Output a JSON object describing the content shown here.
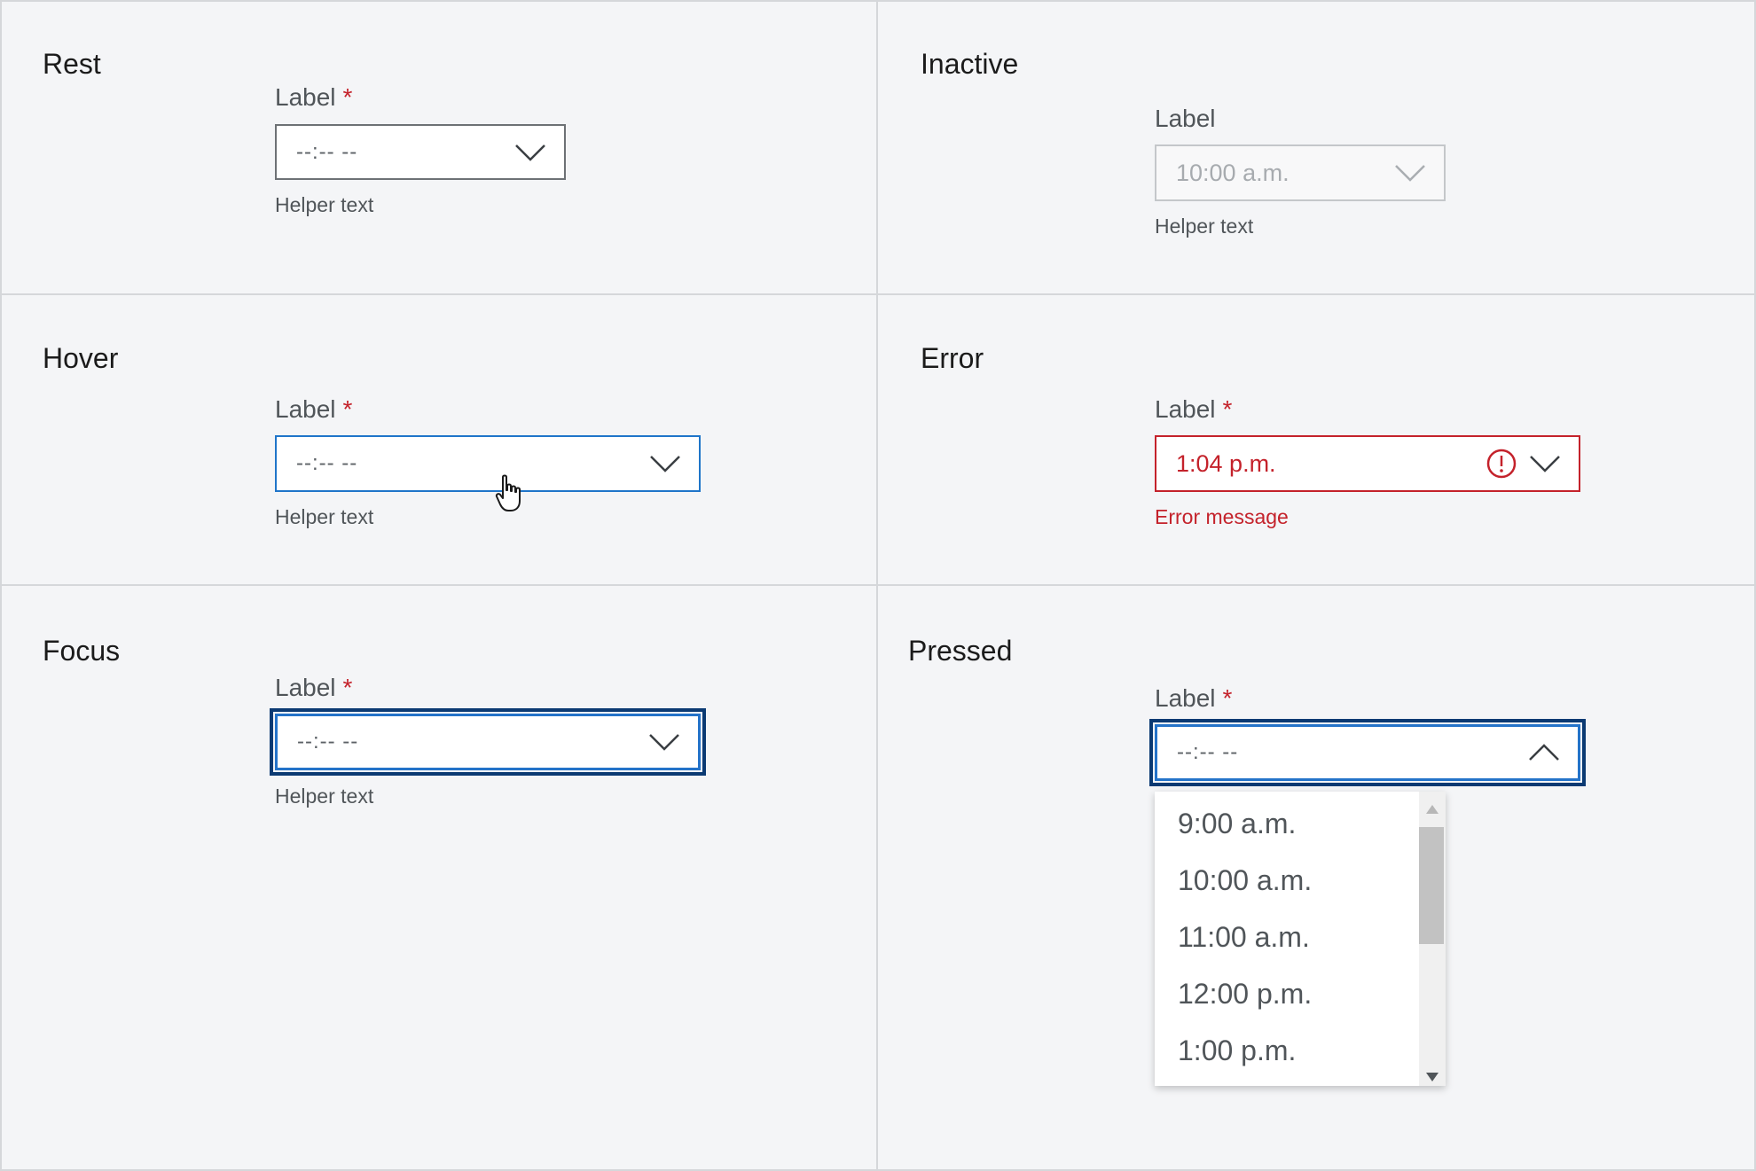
{
  "states": {
    "rest": {
      "title": "Rest",
      "label": "Label",
      "required_mark": "*",
      "value": "--:-- --",
      "helper": "Helper text"
    },
    "inactive": {
      "title": "Inactive",
      "label": "Label",
      "value": "10:00 a.m.",
      "helper": "Helper text"
    },
    "hover": {
      "title": "Hover",
      "label": "Label",
      "required_mark": "*",
      "value": "--:-- --",
      "helper": "Helper text"
    },
    "error": {
      "title": "Error",
      "label": "Label",
      "required_mark": "*",
      "value": "1:04 p.m.",
      "helper": "Error message"
    },
    "focus": {
      "title": "Focus",
      "label": "Label",
      "required_mark": "*",
      "value": "--:-- --",
      "helper": "Helper text"
    },
    "pressed": {
      "title": "Pressed",
      "label": "Label",
      "required_mark": "*",
      "value": "--:-- --",
      "options": [
        "9:00 a.m.",
        "10:00 a.m.",
        "11:00 a.m.",
        "12:00 p.m.",
        "1:00 p.m."
      ]
    }
  },
  "icons": {
    "chevron": "chevron-down-icon",
    "chevron_open": "chevron-up-icon",
    "error": "alert-circle-icon",
    "cursor": "hand-pointer-icon"
  },
  "colors": {
    "required": "#c4222b",
    "error": "#c4222b",
    "hover_border": "#1f75c9",
    "focus_outline": "#0b3a73"
  }
}
